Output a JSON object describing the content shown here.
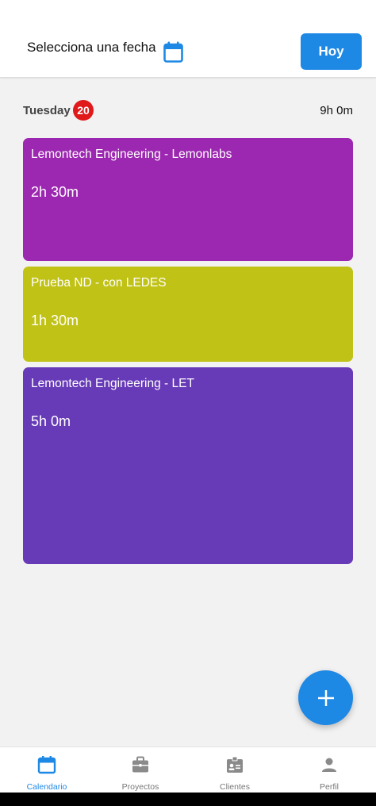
{
  "header": {
    "date_picker_label": "Selecciona una fecha",
    "today_button": "Hoy"
  },
  "day": {
    "name": "Tuesday",
    "number": "20",
    "total": "9h 0m"
  },
  "entries": [
    {
      "title": "Lemontech Engineering - Lemonlabs",
      "duration": "2h 30m",
      "color": "#9c27b0"
    },
    {
      "title": "Prueba ND - con LEDES",
      "duration": "1h 30m",
      "color": "#c0c216"
    },
    {
      "title": "Lemontech Engineering - LET",
      "duration": "5h 0m",
      "color": "#673ab7"
    }
  ],
  "fab": {
    "icon": "plus-icon"
  },
  "tabs": [
    {
      "label": "Calendario",
      "icon": "calendar-icon",
      "active": true
    },
    {
      "label": "Proyectos",
      "icon": "briefcase-icon",
      "active": false
    },
    {
      "label": "Clientes",
      "icon": "contact-card-icon",
      "active": false
    },
    {
      "label": "Perfil",
      "icon": "person-icon",
      "active": false
    }
  ],
  "colors": {
    "accent": "#1e88e5",
    "badge": "#e0191a",
    "inactive": "#8a8a8a"
  }
}
